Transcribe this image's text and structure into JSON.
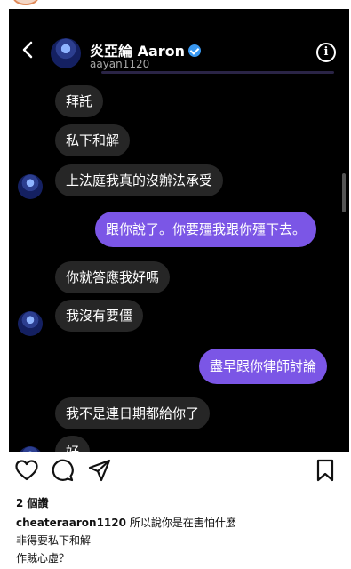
{
  "header": {
    "name": "炎亞綸 Aaron",
    "handle": "aayan1120",
    "info_symbol": "i"
  },
  "messages": [
    {
      "side": "in",
      "text": "拜託"
    },
    {
      "side": "in",
      "text": "私下和解"
    },
    {
      "side": "in",
      "text": "上法庭我真的沒辦法承受"
    },
    {
      "side": "out",
      "text": "跟你說了。你要殭我跟你殭下去。"
    },
    {
      "side": "in",
      "text": "你就答應我好嗎"
    },
    {
      "side": "in",
      "text": "我沒有要僵"
    },
    {
      "side": "out",
      "text": "盡早跟你律師討論"
    },
    {
      "side": "in",
      "text": "我不是連日期都給你了"
    },
    {
      "side": "in",
      "text": "好"
    }
  ],
  "post": {
    "views": "2 個讚",
    "username": "cheateraaron1120",
    "caption_line1": "所以說你是在害怕什麼",
    "caption_line2": "非得要私下和解",
    "caption_line3": "作賊心虛？"
  },
  "colors": {
    "outgoing_bubble": "#7b56e6",
    "incoming_bubble": "#262626",
    "screen_bg": "#000000"
  }
}
